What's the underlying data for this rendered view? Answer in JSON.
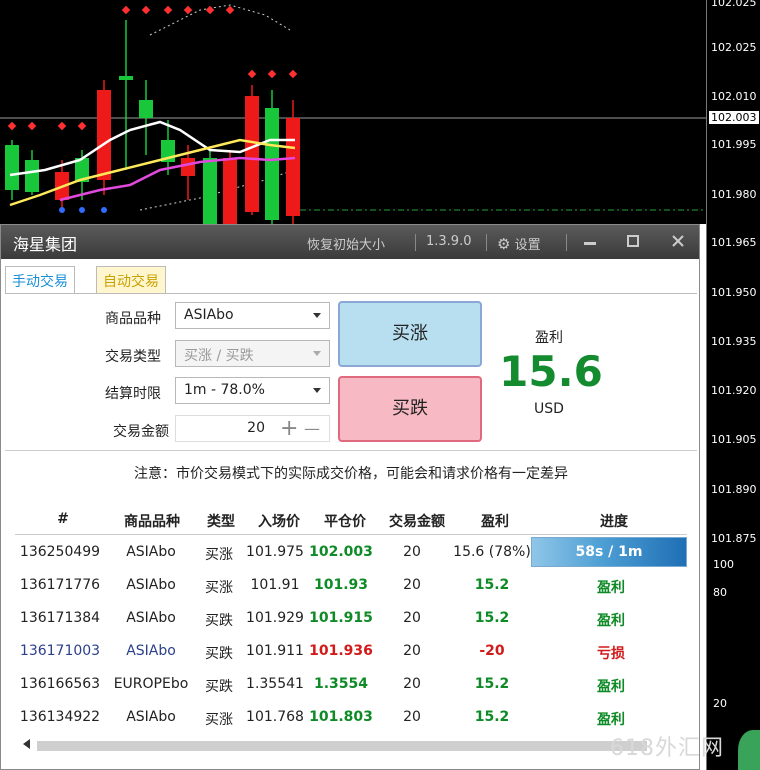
{
  "price_axis": {
    "ticks": [
      "102.025",
      "102.010",
      "102.003",
      "101.995",
      "101.980",
      "101.965",
      "101.950",
      "101.935",
      "101.920",
      "101.905",
      "101.890",
      "101.875",
      "100",
      "80",
      "20"
    ],
    "highlight_index": 2
  },
  "colors": {
    "bull": "#19c83a",
    "bear": "#ee1a1a",
    "ma_white": "#ffffff",
    "ma_yellow": "#ffe85a",
    "ma_magenta": "#e24adf",
    "signal_red": "#ff3030",
    "signal_blue": "#2f6bff",
    "profit_green": "#138b2e",
    "loss_red": "#d21a1a"
  },
  "window": {
    "title": "海星集团",
    "reset_label": "恢复初始大小",
    "version": "1.3.9.0",
    "settings_label": "设置",
    "minimize_icon": "minimize-icon",
    "maximize_icon": "maximize-icon",
    "close_icon": "close-icon"
  },
  "tabs": [
    "手动交易",
    "自动交易"
  ],
  "form": {
    "product_label": "商品品种",
    "product_value": "ASIAbo",
    "trade_type_label": "交易类型",
    "trade_type_value": "买涨 / 买跌",
    "expiry_label": "结算时限",
    "expiry_value": "1m - 78.0%",
    "amount_label": "交易金额",
    "amount_value": "20",
    "plus": "+",
    "minus": "—"
  },
  "actions": {
    "buy_up": "买涨",
    "buy_down": "买跌"
  },
  "profit": {
    "label": "盈利",
    "value": "15.6",
    "unit": "USD"
  },
  "notice": "注意：市价交易模式下的实际成交价格，可能会和请求价格有一定差异",
  "table": {
    "headers": [
      "#",
      "商品品种",
      "类型",
      "入场价",
      "平仓价",
      "交易金额",
      "盈利",
      "进度"
    ],
    "rows": [
      {
        "id": "136250499",
        "product": "ASIAbo",
        "type": "买涨",
        "entry": "101.975",
        "exit": "102.003",
        "amount": "20",
        "profit": "15.6 (78%)",
        "progress": "58s / 1m"
      },
      {
        "id": "136171776",
        "product": "ASIAbo",
        "type": "买涨",
        "entry": "101.91",
        "exit": "101.93",
        "amount": "20",
        "profit": "15.2",
        "progress": "盈利"
      },
      {
        "id": "136171384",
        "product": "ASIAbo",
        "type": "买跌",
        "entry": "101.929",
        "exit": "101.915",
        "amount": "20",
        "profit": "15.2",
        "progress": "盈利"
      },
      {
        "id": "136171003",
        "product": "ASIAbo",
        "type": "买跌",
        "entry": "101.911",
        "exit": "101.936",
        "amount": "20",
        "profit": "-20",
        "progress": "亏损"
      },
      {
        "id": "136166563",
        "product": "EUROPEbo",
        "type": "买跌",
        "entry": "1.35541",
        "exit": "1.3554",
        "amount": "20",
        "profit": "15.2",
        "progress": "盈利"
      },
      {
        "id": "136134922",
        "product": "ASIAbo",
        "type": "买涨",
        "entry": "101.768",
        "exit": "101.803",
        "amount": "20",
        "profit": "15.2",
        "progress": "盈利"
      }
    ]
  },
  "watermark": "618外汇网"
}
